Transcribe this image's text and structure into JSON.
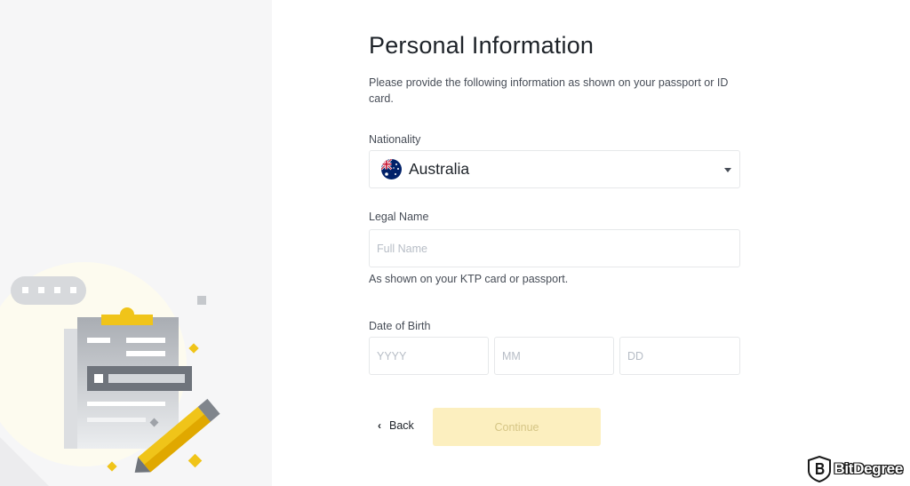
{
  "form": {
    "title": "Personal Information",
    "subtitle": "Please provide the following information as shown on your passport or ID card.",
    "nationality": {
      "label": "Nationality",
      "selected": "Australia",
      "flag_icon": "australia-flag-icon"
    },
    "legal_name": {
      "label": "Legal Name",
      "placeholder": "Full Name",
      "value": "",
      "hint": "As shown on your KTP card or passport."
    },
    "dob": {
      "label": "Date of Birth",
      "year_placeholder": "YYYY",
      "month_placeholder": "MM",
      "day_placeholder": "DD"
    },
    "back_label": "Back",
    "continue_label": "Continue",
    "continue_enabled": false
  },
  "colors": {
    "accent": "#f0b90b",
    "continue_disabled_bg": "#fcefbf",
    "continue_disabled_text": "#d5c585",
    "left_panel_bg": "#f6f6f7",
    "border": "#e6e8ea"
  },
  "watermark": {
    "text": "BitDegree",
    "icon": "bitdegree-logo-icon"
  }
}
